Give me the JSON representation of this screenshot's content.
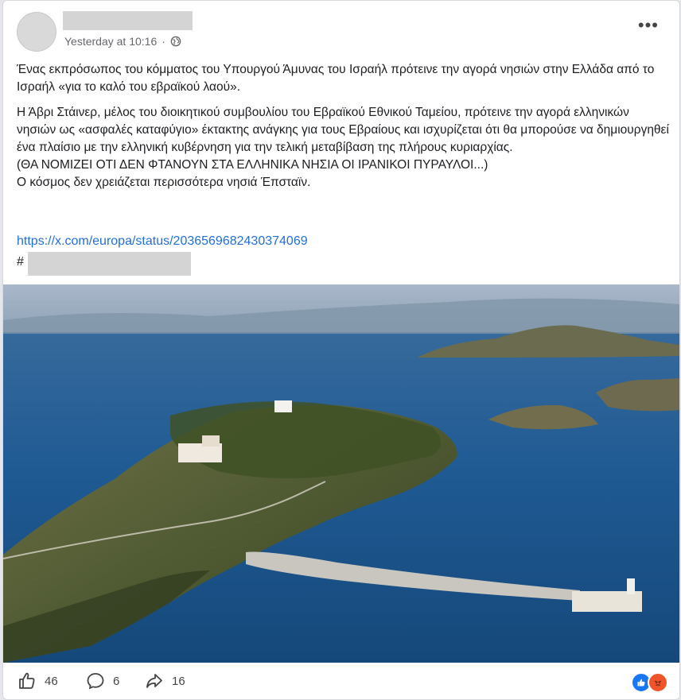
{
  "post": {
    "timestamp": "Yesterday at 10:16",
    "separator": "·",
    "privacy_icon": "globe-icon",
    "more_label": "•••",
    "paragraph1": "Ένας εκπρόσωπος του κόμματος του Υπουργού Άμυνας του Ισραήλ πρότεινε την αγορά νησιών στην Ελλάδα από το Ισραήλ «για το καλό του εβραϊκού λαού».",
    "paragraph2": "Η Άβρι Στάινερ, μέλος του διοικητικού συμβουλίου του Εβραϊκού Εθνικού Ταμείου, πρότεινε την αγορά ελληνικών νησιών ως «ασφαλές καταφύγιο» έκτακτης ανάγκης για τους Εβραίους και ισχυρίζεται ότι θα μπορούσε να δημιουργηθεί ένα πλαίσιο με την ελληνική κυβέρνηση για την τελική μεταβίβαση της πλήρους κυριαρχίας.",
    "line3": "(ΘΑ ΝΟΜΙΖΕΙ ΟΤΙ ΔΕΝ ΦΤΑΝΟΥΝ ΣΤΑ ΕΛΛΗΝΙΚΑ ΝΗΣΙΑ ΟΙ ΙΡΑΝΙΚΟΙ ΠΥΡΑΥΛΟΙ...)",
    "line4": "Ο κόσμος δεν χρειάζεται περισσότερα νησιά Έπσταϊν.",
    "link": "https://x.com/europa/status/2036569682430374069",
    "hashtag_prefix": "#"
  },
  "footer": {
    "likes": "46",
    "comments": "6",
    "shares": "16",
    "reactions": [
      "like-icon",
      "angry-icon"
    ]
  },
  "colors": {
    "link": "#216fdb",
    "like_blue": "#1877f2",
    "angry_orange": "#f0552a"
  }
}
